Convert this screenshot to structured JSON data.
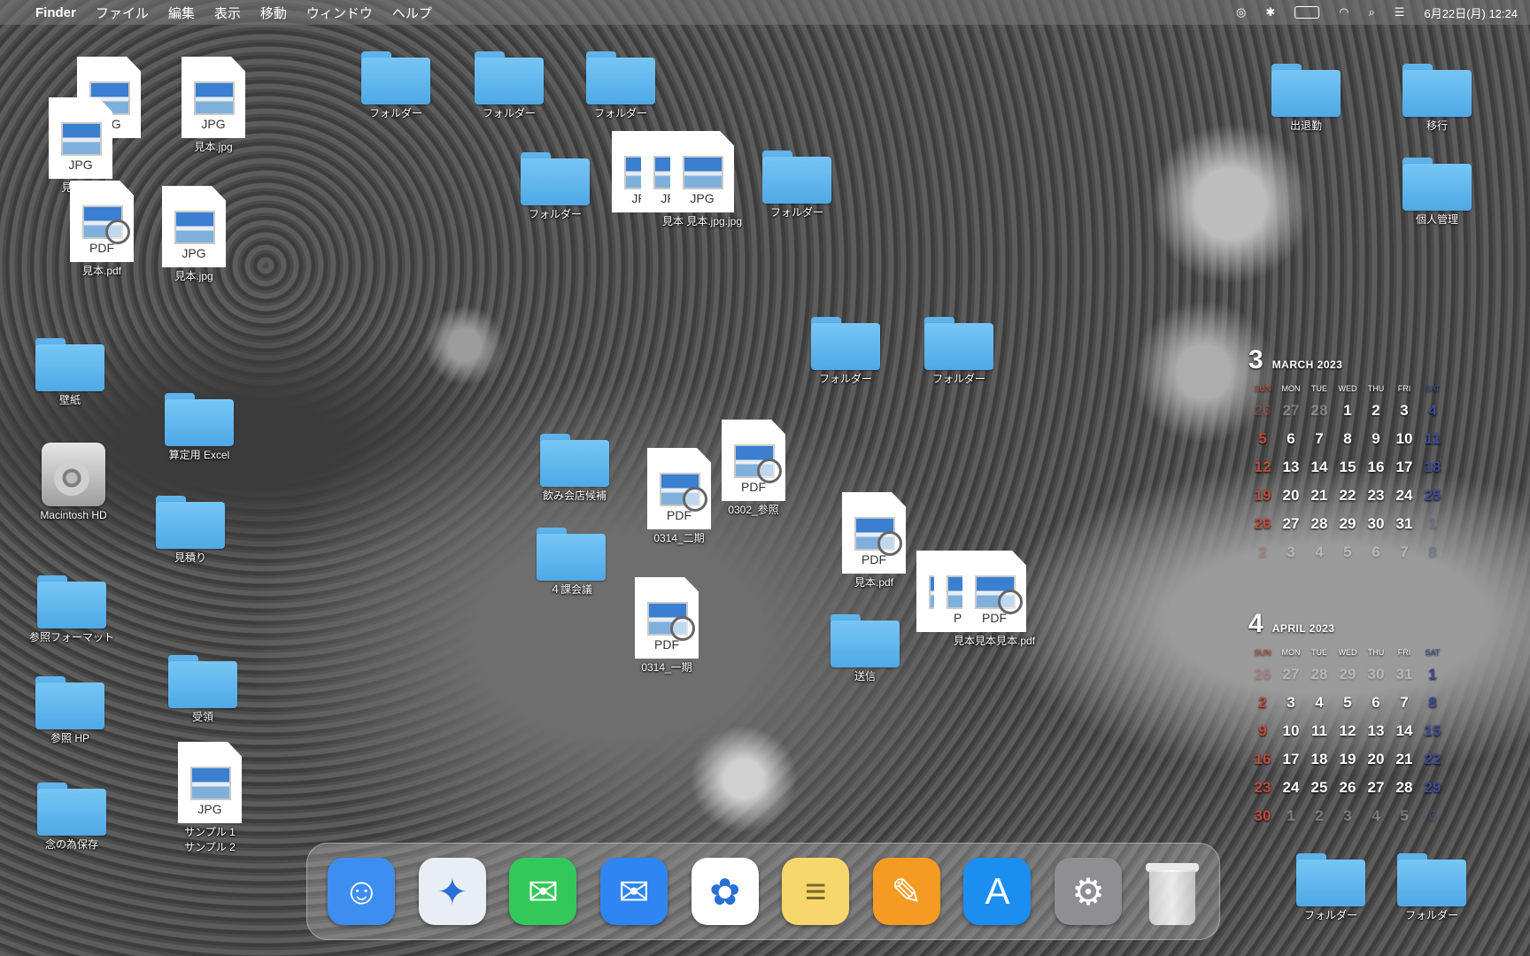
{
  "menubar": {
    "apple": "",
    "app_name": "Finder",
    "menus": [
      "ファイル",
      "編集",
      "表示",
      "移動",
      "ウィンドウ",
      "ヘルプ"
    ],
    "datetime": "6月22日(月) 12:24"
  },
  "desktop_icons": {
    "f1": "フォルダー",
    "f2": "フォルダー",
    "f3": "フォルダー",
    "f4": "フォルダー",
    "f5": "フォルダー",
    "f6": "フォルダー",
    "f7": "フォルダー",
    "shuttaikin": "出退勤",
    "ikou": "移行",
    "kojin": "個人管理",
    "kabegami": "壁紙",
    "santei": "算定用 Excel",
    "mac_hd": "Macintosh HD",
    "mitsumori": "見積り",
    "sansho_format": "参照フォーマット",
    "juryo": "受領",
    "sansho_hp": "参照 HP",
    "nennotame": "念の為保存",
    "nomikai": "飲み会店候補",
    "kakakaigi": "４課会議",
    "soushin": "送信",
    "f_br1": "フォルダー",
    "f_br2": "フォルダー",
    "doc_0314_2": "0314_二期",
    "doc_0302": "0302_参照",
    "doc_mihon_pdf": "見本.pdf",
    "doc_0314_1": "0314_一期",
    "doc_mihon_stack": "見本見本見本.pdf",
    "doc_mihon_jpg_stack": "見本 見本.jpg.jpg",
    "tl_jpg_a": "見本.jpg",
    "tl_jpg_b": "見本.jpg",
    "tl_pdf": "見本.pdf",
    "tl_pdf2": "見本.pdf",
    "tl_jpg_c": "見本.jpg",
    "tl_jpg_d": "見本.jpg",
    "sample1": "サンプル 1",
    "sample2": "サンプル 2",
    "ext_jpg": "JPG",
    "ext_pdf": "PDF"
  },
  "calendar_march": {
    "month_num": "3",
    "month_name": "MARCH 2023",
    "dows": [
      "SUN",
      "MON",
      "TUE",
      "WED",
      "THU",
      "FRI",
      "SAT"
    ],
    "days": [
      "26",
      "27",
      "28",
      "1",
      "2",
      "3",
      "4",
      "5",
      "6",
      "7",
      "8",
      "9",
      "10",
      "11",
      "12",
      "13",
      "14",
      "15",
      "16",
      "17",
      "18",
      "19",
      "20",
      "21",
      "22",
      "23",
      "24",
      "25",
      "26",
      "27",
      "28",
      "29",
      "30",
      "31",
      "1",
      "2",
      "3",
      "4",
      "5",
      "6",
      "7",
      "8"
    ]
  },
  "calendar_april": {
    "month_num": "4",
    "month_name": "APRIL 2023",
    "dows": [
      "SUN",
      "MON",
      "TUE",
      "WED",
      "THU",
      "FRI",
      "SAT"
    ],
    "days": [
      "26",
      "27",
      "28",
      "29",
      "30",
      "31",
      "1",
      "2",
      "3",
      "4",
      "5",
      "6",
      "7",
      "8",
      "9",
      "10",
      "11",
      "12",
      "13",
      "14",
      "15",
      "16",
      "17",
      "18",
      "19",
      "20",
      "21",
      "22",
      "23",
      "24",
      "25",
      "26",
      "27",
      "28",
      "29",
      "30",
      "1",
      "2",
      "3",
      "4",
      "5",
      "6"
    ]
  },
  "dock": {
    "apps": [
      {
        "name": "finder",
        "color": "#3d8ef0"
      },
      {
        "name": "safari",
        "color": "#e9eef5"
      },
      {
        "name": "messages",
        "color": "#34c759"
      },
      {
        "name": "mail",
        "color": "#2f86f2"
      },
      {
        "name": "photos",
        "color": "#ffffff"
      },
      {
        "name": "notes",
        "color": "#f7d76b"
      },
      {
        "name": "pages",
        "color": "#f59b23"
      },
      {
        "name": "app-store",
        "color": "#1c8ef0"
      },
      {
        "name": "system-preferences",
        "color": "#8e8e93"
      },
      {
        "name": "trash",
        "color": "#dddddd"
      }
    ]
  }
}
